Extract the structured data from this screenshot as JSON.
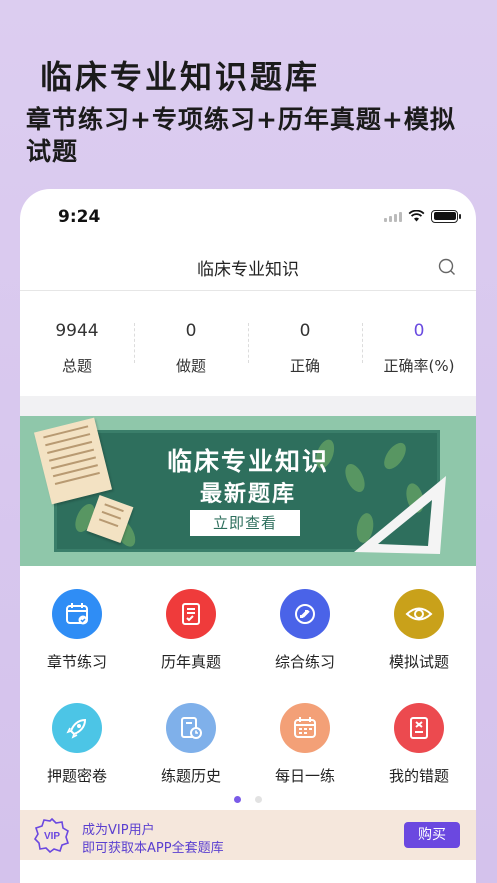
{
  "promo": {
    "headline": "临床专业知识题库",
    "subline": "章节练习+专项练习+历年真题+模拟试题"
  },
  "status_bar": {
    "time": "9:24"
  },
  "nav": {
    "title": "临床专业知识",
    "search_icon": "search-icon"
  },
  "stats": [
    {
      "value": "9944",
      "label": "总题"
    },
    {
      "value": "0",
      "label": "做题"
    },
    {
      "value": "0",
      "label": "正确"
    },
    {
      "value": "0",
      "label": "正确率(%)"
    }
  ],
  "banner": {
    "line1": "临床专业知识",
    "line2": "最新题库",
    "button": "立即查看"
  },
  "features": [
    {
      "label": "章节练习",
      "icon": "calendar-check-icon",
      "color": "#2f8df5"
    },
    {
      "label": "历年真题",
      "icon": "document-check-icon",
      "color": "#ef3b3b"
    },
    {
      "label": "综合练习",
      "icon": "swap-icon",
      "color": "#4a63e8"
    },
    {
      "label": "模拟试题",
      "icon": "eye-icon",
      "color": "#c9a11a"
    },
    {
      "label": "押题密卷",
      "icon": "rocket-icon",
      "color": "#4cc5e6"
    },
    {
      "label": "练题历史",
      "icon": "history-icon",
      "color": "#7fb0ea"
    },
    {
      "label": "每日一练",
      "icon": "calendar-icon",
      "color": "#f3a077"
    },
    {
      "label": "我的错题",
      "icon": "error-book-icon",
      "color": "#ec4a4f"
    }
  ],
  "vip": {
    "badge": "VIP",
    "line1": "成为VIP用户",
    "line2": "即可获取本APP全套题库",
    "button": "购买"
  },
  "colors": {
    "accent": "#6b48e0",
    "banner_bg": "#8fc7aa",
    "board": "#2e6f5d"
  }
}
